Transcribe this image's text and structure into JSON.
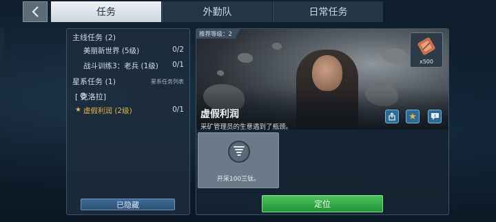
{
  "tabs": [
    {
      "label": "任务",
      "active": true
    },
    {
      "label": "外勤队",
      "active": false
    },
    {
      "label": "日常任务",
      "active": false
    }
  ],
  "back_icon": "chevron-left-icon",
  "left_panel": {
    "main_section": "主线任务 (2)",
    "main_quests": [
      {
        "name": "美丽新世界 (5级)",
        "progress": "0/2"
      },
      {
        "name": "战斗训练3：老兵 (1级)",
        "progress": "0/1"
      }
    ],
    "galaxy_section": "星系任务 (1)",
    "galaxy_list_link": "星系任务列表",
    "location": "[ 克洛拉]",
    "galaxy_quests": [
      {
        "name": "虚假利润 (2级)",
        "progress": "0/1",
        "active": true
      }
    ],
    "hide_button": "已隐藏"
  },
  "detail": {
    "recommended_level": "推荐等级：2",
    "reward_count": "x500",
    "reward_icon": "resource-roll-icon",
    "title": "虚假利润",
    "description": "采矿管理员的生意遇到了瓶颈。",
    "action_icons": [
      "share-icon",
      "star-icon",
      "chat-icon"
    ],
    "objective_icon": "tornado-icon",
    "objective_text": "开采100三钛。",
    "locate_button": "定位"
  },
  "colors": {
    "accent_green": "#2fa845",
    "accent_blue": "#2d6a96",
    "star_gold": "#e0b84a"
  }
}
